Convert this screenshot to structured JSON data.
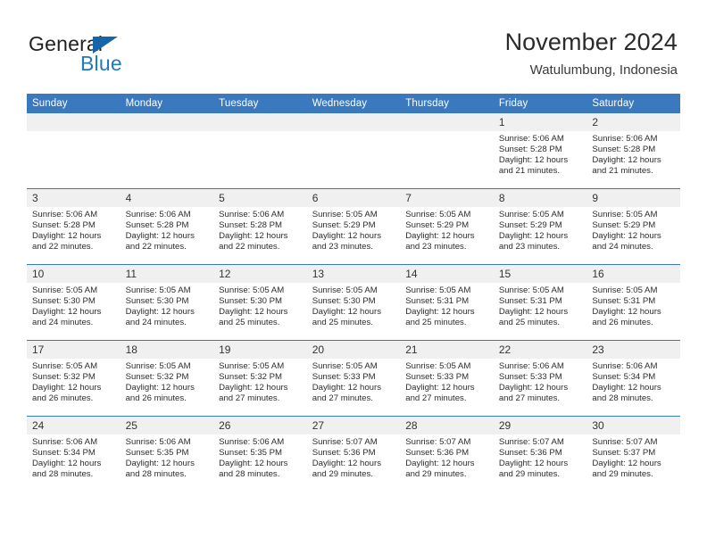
{
  "brand": {
    "name_part1": "General",
    "name_part2": "Blue",
    "logo_icon": "triangle-icon"
  },
  "header": {
    "title": "November 2024",
    "location": "Watulumbung, Indonesia"
  },
  "colors": {
    "header_blue": "#3b79bf",
    "brand_blue": "#2079c4",
    "daynum_band": "#f0f0f0"
  },
  "weekdays": [
    "Sunday",
    "Monday",
    "Tuesday",
    "Wednesday",
    "Thursday",
    "Friday",
    "Saturday"
  ],
  "weeks": [
    [
      {
        "day": "",
        "empty": true
      },
      {
        "day": "",
        "empty": true
      },
      {
        "day": "",
        "empty": true
      },
      {
        "day": "",
        "empty": true
      },
      {
        "day": "",
        "empty": true
      },
      {
        "day": "1",
        "sunrise": "Sunrise: 5:06 AM",
        "sunset": "Sunset: 5:28 PM",
        "daylight1": "Daylight: 12 hours",
        "daylight2": "and 21 minutes."
      },
      {
        "day": "2",
        "sunrise": "Sunrise: 5:06 AM",
        "sunset": "Sunset: 5:28 PM",
        "daylight1": "Daylight: 12 hours",
        "daylight2": "and 21 minutes."
      }
    ],
    [
      {
        "day": "3",
        "sunrise": "Sunrise: 5:06 AM",
        "sunset": "Sunset: 5:28 PM",
        "daylight1": "Daylight: 12 hours",
        "daylight2": "and 22 minutes."
      },
      {
        "day": "4",
        "sunrise": "Sunrise: 5:06 AM",
        "sunset": "Sunset: 5:28 PM",
        "daylight1": "Daylight: 12 hours",
        "daylight2": "and 22 minutes."
      },
      {
        "day": "5",
        "sunrise": "Sunrise: 5:06 AM",
        "sunset": "Sunset: 5:28 PM",
        "daylight1": "Daylight: 12 hours",
        "daylight2": "and 22 minutes."
      },
      {
        "day": "6",
        "sunrise": "Sunrise: 5:05 AM",
        "sunset": "Sunset: 5:29 PM",
        "daylight1": "Daylight: 12 hours",
        "daylight2": "and 23 minutes."
      },
      {
        "day": "7",
        "sunrise": "Sunrise: 5:05 AM",
        "sunset": "Sunset: 5:29 PM",
        "daylight1": "Daylight: 12 hours",
        "daylight2": "and 23 minutes."
      },
      {
        "day": "8",
        "sunrise": "Sunrise: 5:05 AM",
        "sunset": "Sunset: 5:29 PM",
        "daylight1": "Daylight: 12 hours",
        "daylight2": "and 23 minutes."
      },
      {
        "day": "9",
        "sunrise": "Sunrise: 5:05 AM",
        "sunset": "Sunset: 5:29 PM",
        "daylight1": "Daylight: 12 hours",
        "daylight2": "and 24 minutes."
      }
    ],
    [
      {
        "day": "10",
        "sunrise": "Sunrise: 5:05 AM",
        "sunset": "Sunset: 5:30 PM",
        "daylight1": "Daylight: 12 hours",
        "daylight2": "and 24 minutes."
      },
      {
        "day": "11",
        "sunrise": "Sunrise: 5:05 AM",
        "sunset": "Sunset: 5:30 PM",
        "daylight1": "Daylight: 12 hours",
        "daylight2": "and 24 minutes."
      },
      {
        "day": "12",
        "sunrise": "Sunrise: 5:05 AM",
        "sunset": "Sunset: 5:30 PM",
        "daylight1": "Daylight: 12 hours",
        "daylight2": "and 25 minutes."
      },
      {
        "day": "13",
        "sunrise": "Sunrise: 5:05 AM",
        "sunset": "Sunset: 5:30 PM",
        "daylight1": "Daylight: 12 hours",
        "daylight2": "and 25 minutes."
      },
      {
        "day": "14",
        "sunrise": "Sunrise: 5:05 AM",
        "sunset": "Sunset: 5:31 PM",
        "daylight1": "Daylight: 12 hours",
        "daylight2": "and 25 minutes."
      },
      {
        "day": "15",
        "sunrise": "Sunrise: 5:05 AM",
        "sunset": "Sunset: 5:31 PM",
        "daylight1": "Daylight: 12 hours",
        "daylight2": "and 25 minutes."
      },
      {
        "day": "16",
        "sunrise": "Sunrise: 5:05 AM",
        "sunset": "Sunset: 5:31 PM",
        "daylight1": "Daylight: 12 hours",
        "daylight2": "and 26 minutes."
      }
    ],
    [
      {
        "day": "17",
        "sunrise": "Sunrise: 5:05 AM",
        "sunset": "Sunset: 5:32 PM",
        "daylight1": "Daylight: 12 hours",
        "daylight2": "and 26 minutes."
      },
      {
        "day": "18",
        "sunrise": "Sunrise: 5:05 AM",
        "sunset": "Sunset: 5:32 PM",
        "daylight1": "Daylight: 12 hours",
        "daylight2": "and 26 minutes."
      },
      {
        "day": "19",
        "sunrise": "Sunrise: 5:05 AM",
        "sunset": "Sunset: 5:32 PM",
        "daylight1": "Daylight: 12 hours",
        "daylight2": "and 27 minutes."
      },
      {
        "day": "20",
        "sunrise": "Sunrise: 5:05 AM",
        "sunset": "Sunset: 5:33 PM",
        "daylight1": "Daylight: 12 hours",
        "daylight2": "and 27 minutes."
      },
      {
        "day": "21",
        "sunrise": "Sunrise: 5:05 AM",
        "sunset": "Sunset: 5:33 PM",
        "daylight1": "Daylight: 12 hours",
        "daylight2": "and 27 minutes."
      },
      {
        "day": "22",
        "sunrise": "Sunrise: 5:06 AM",
        "sunset": "Sunset: 5:33 PM",
        "daylight1": "Daylight: 12 hours",
        "daylight2": "and 27 minutes."
      },
      {
        "day": "23",
        "sunrise": "Sunrise: 5:06 AM",
        "sunset": "Sunset: 5:34 PM",
        "daylight1": "Daylight: 12 hours",
        "daylight2": "and 28 minutes."
      }
    ],
    [
      {
        "day": "24",
        "sunrise": "Sunrise: 5:06 AM",
        "sunset": "Sunset: 5:34 PM",
        "daylight1": "Daylight: 12 hours",
        "daylight2": "and 28 minutes."
      },
      {
        "day": "25",
        "sunrise": "Sunrise: 5:06 AM",
        "sunset": "Sunset: 5:35 PM",
        "daylight1": "Daylight: 12 hours",
        "daylight2": "and 28 minutes."
      },
      {
        "day": "26",
        "sunrise": "Sunrise: 5:06 AM",
        "sunset": "Sunset: 5:35 PM",
        "daylight1": "Daylight: 12 hours",
        "daylight2": "and 28 minutes."
      },
      {
        "day": "27",
        "sunrise": "Sunrise: 5:07 AM",
        "sunset": "Sunset: 5:36 PM",
        "daylight1": "Daylight: 12 hours",
        "daylight2": "and 29 minutes."
      },
      {
        "day": "28",
        "sunrise": "Sunrise: 5:07 AM",
        "sunset": "Sunset: 5:36 PM",
        "daylight1": "Daylight: 12 hours",
        "daylight2": "and 29 minutes."
      },
      {
        "day": "29",
        "sunrise": "Sunrise: 5:07 AM",
        "sunset": "Sunset: 5:36 PM",
        "daylight1": "Daylight: 12 hours",
        "daylight2": "and 29 minutes."
      },
      {
        "day": "30",
        "sunrise": "Sunrise: 5:07 AM",
        "sunset": "Sunset: 5:37 PM",
        "daylight1": "Daylight: 12 hours",
        "daylight2": "and 29 minutes."
      }
    ]
  ]
}
